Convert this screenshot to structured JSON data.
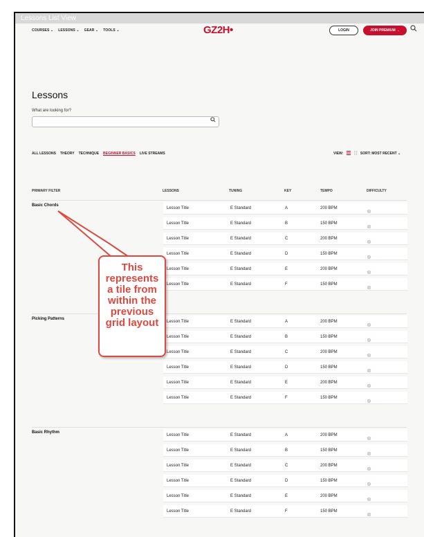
{
  "window": {
    "title": "Lessons List View"
  },
  "nav": {
    "menu": [
      "COURSES ⌄",
      "LESSONS ⌄",
      "GEAR ⌄",
      "TOOLS ⌄"
    ],
    "logo": "GZ2H•",
    "login_label": "LOGIN",
    "premium_label": "JOIN PREMIUM →",
    "search_icon": "search-icon"
  },
  "page": {
    "title": "Lessons",
    "search_label": "What are looking for?",
    "search_placeholder": ""
  },
  "tabs": [
    {
      "label": "ALL LESSONS",
      "active": false
    },
    {
      "label": "THEORY",
      "active": false
    },
    {
      "label": "TECHNIQUE",
      "active": false
    },
    {
      "label": "BEGINNER BASICS",
      "active": true
    },
    {
      "label": "LIVE STREAMS",
      "active": false
    }
  ],
  "toolbar": {
    "view_label": "VIEW:",
    "sort_label": "SORT: MOST RECENT ⌄"
  },
  "columns": [
    "PRIMARY FILTER",
    "LESSONS",
    "TUNING",
    "KEY",
    "TEMPO",
    "DIFFICULTY"
  ],
  "groups": [
    {
      "name": "Basic Chords",
      "rows": [
        {
          "title": "Lesson Title",
          "tuning": "E Standard",
          "key": "A",
          "tempo": "200 BPM",
          "difficulty": 3
        },
        {
          "title": "Lesson Title",
          "tuning": "E Standard",
          "key": "B",
          "tempo": "150 BPM",
          "difficulty": 3
        },
        {
          "title": "Lesson Title",
          "tuning": "E Standard",
          "key": "C",
          "tempo": "200 BPM",
          "difficulty": 3
        },
        {
          "title": "Lesson Title",
          "tuning": "E Standard",
          "key": "D",
          "tempo": "150 BPM",
          "difficulty": 3
        },
        {
          "title": "Lesson Title",
          "tuning": "E Standard",
          "key": "E",
          "tempo": "200 BPM",
          "difficulty": 3
        },
        {
          "title": "Lesson Title",
          "tuning": "E Standard",
          "key": "F",
          "tempo": "150 BPM",
          "difficulty": 3
        }
      ]
    },
    {
      "name": "Picking Patterns",
      "rows": [
        {
          "title": "Lesson Title",
          "tuning": "E Standard",
          "key": "A",
          "tempo": "200 BPM",
          "difficulty": 3
        },
        {
          "title": "Lesson Title",
          "tuning": "E Standard",
          "key": "B",
          "tempo": "150 BPM",
          "difficulty": 3
        },
        {
          "title": "Lesson Title",
          "tuning": "E Standard",
          "key": "C",
          "tempo": "200 BPM",
          "difficulty": 3
        },
        {
          "title": "Lesson Title",
          "tuning": "E Standard",
          "key": "D",
          "tempo": "150 BPM",
          "difficulty": 3
        },
        {
          "title": "Lesson Title",
          "tuning": "E Standard",
          "key": "E",
          "tempo": "200 BPM",
          "difficulty": 3
        },
        {
          "title": "Lesson Title",
          "tuning": "E Standard",
          "key": "F",
          "tempo": "150 BPM",
          "difficulty": 3
        }
      ]
    },
    {
      "name": "Basic Rhythm",
      "rows": [
        {
          "title": "Lesson Title",
          "tuning": "E Standard",
          "key": "A",
          "tempo": "200 BPM",
          "difficulty": 3
        },
        {
          "title": "Lesson Title",
          "tuning": "E Standard",
          "key": "B",
          "tempo": "150 BPM",
          "difficulty": 3
        },
        {
          "title": "Lesson Title",
          "tuning": "E Standard",
          "key": "C",
          "tempo": "200 BPM",
          "difficulty": 3
        },
        {
          "title": "Lesson Title",
          "tuning": "E Standard",
          "key": "D",
          "tempo": "150 BPM",
          "difficulty": 3
        },
        {
          "title": "Lesson Title",
          "tuning": "E Standard",
          "key": "E",
          "tempo": "200 BPM",
          "difficulty": 3
        },
        {
          "title": "Lesson Title",
          "tuning": "E Standard",
          "key": "F",
          "tempo": "150 BPM",
          "difficulty": 3
        }
      ]
    }
  ],
  "difficulty_max": 5,
  "callout": {
    "lines": [
      "This",
      "represents",
      "a tile from",
      "within the",
      "previous",
      "grid layout"
    ]
  },
  "colors": {
    "accent": "#c8102e",
    "callout": "#e0473f"
  }
}
